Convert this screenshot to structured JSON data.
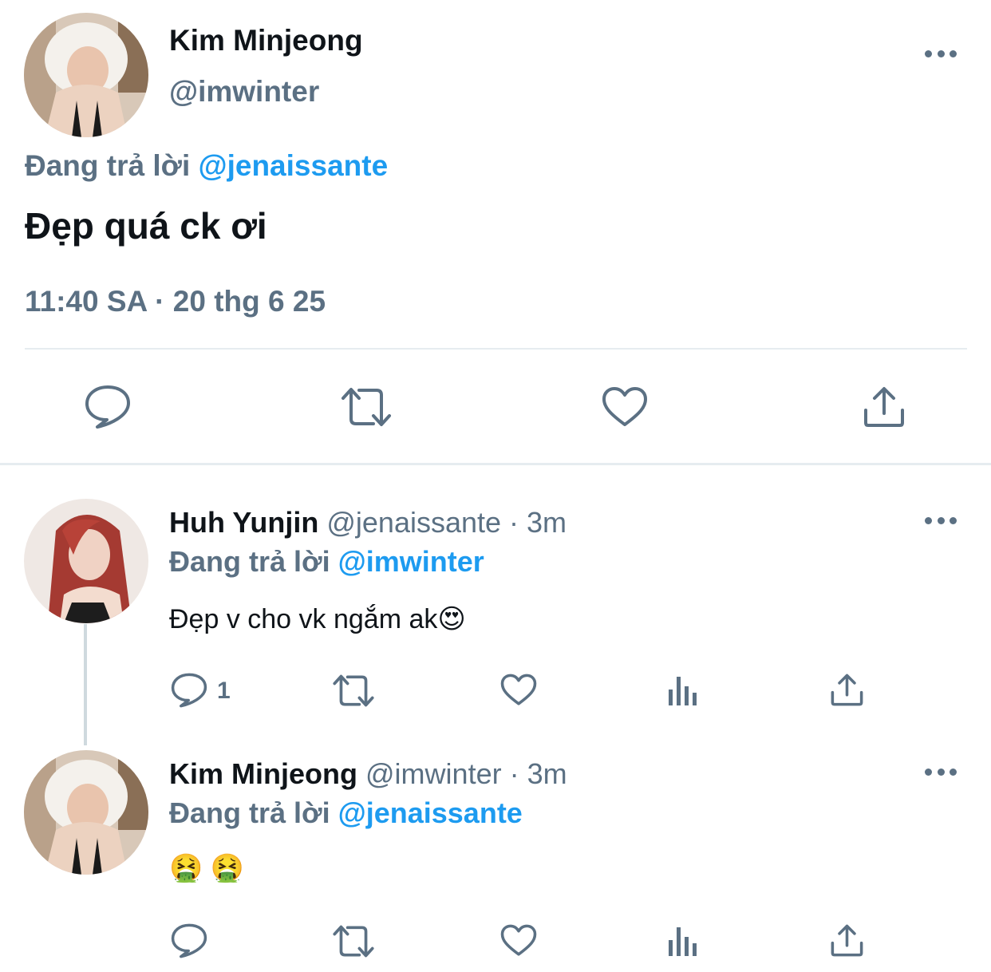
{
  "main_tweet": {
    "author_name": "Kim Minjeong",
    "author_handle": "@imwinter",
    "reply_prefix": "Đang trả lời ",
    "reply_to": "@jenaissante",
    "text": "Đẹp quá ck ơi",
    "timestamp": "11:40 SA · 20 thg 6 25",
    "actions": [
      "reply-icon",
      "retweet-icon",
      "like-icon",
      "share-icon"
    ]
  },
  "replies": [
    {
      "author_name": "Huh Yunjin",
      "author_meta": "@jenaissante · 3m",
      "reply_prefix": "Đang trả lời ",
      "reply_to": "@imwinter",
      "text": "Đẹp v cho vk ngắm ak",
      "text_emoji": "😍",
      "reply_count": "1",
      "actions": [
        "reply-icon",
        "retweet-icon",
        "like-icon",
        "analytics-icon",
        "share-icon"
      ]
    },
    {
      "author_name": "Kim Minjeong",
      "author_meta": "@imwinter · 3m",
      "reply_prefix": "Đang trả lời ",
      "reply_to": "@jenaissante",
      "text": "🤮 🤮",
      "actions": [
        "reply-icon",
        "retweet-icon",
        "like-icon",
        "analytics-icon",
        "share-icon"
      ]
    }
  ],
  "colors": {
    "text": "#0f1419",
    "muted": "#5b7083",
    "link": "#1d9bf0",
    "divider": "#e6ecf0"
  }
}
